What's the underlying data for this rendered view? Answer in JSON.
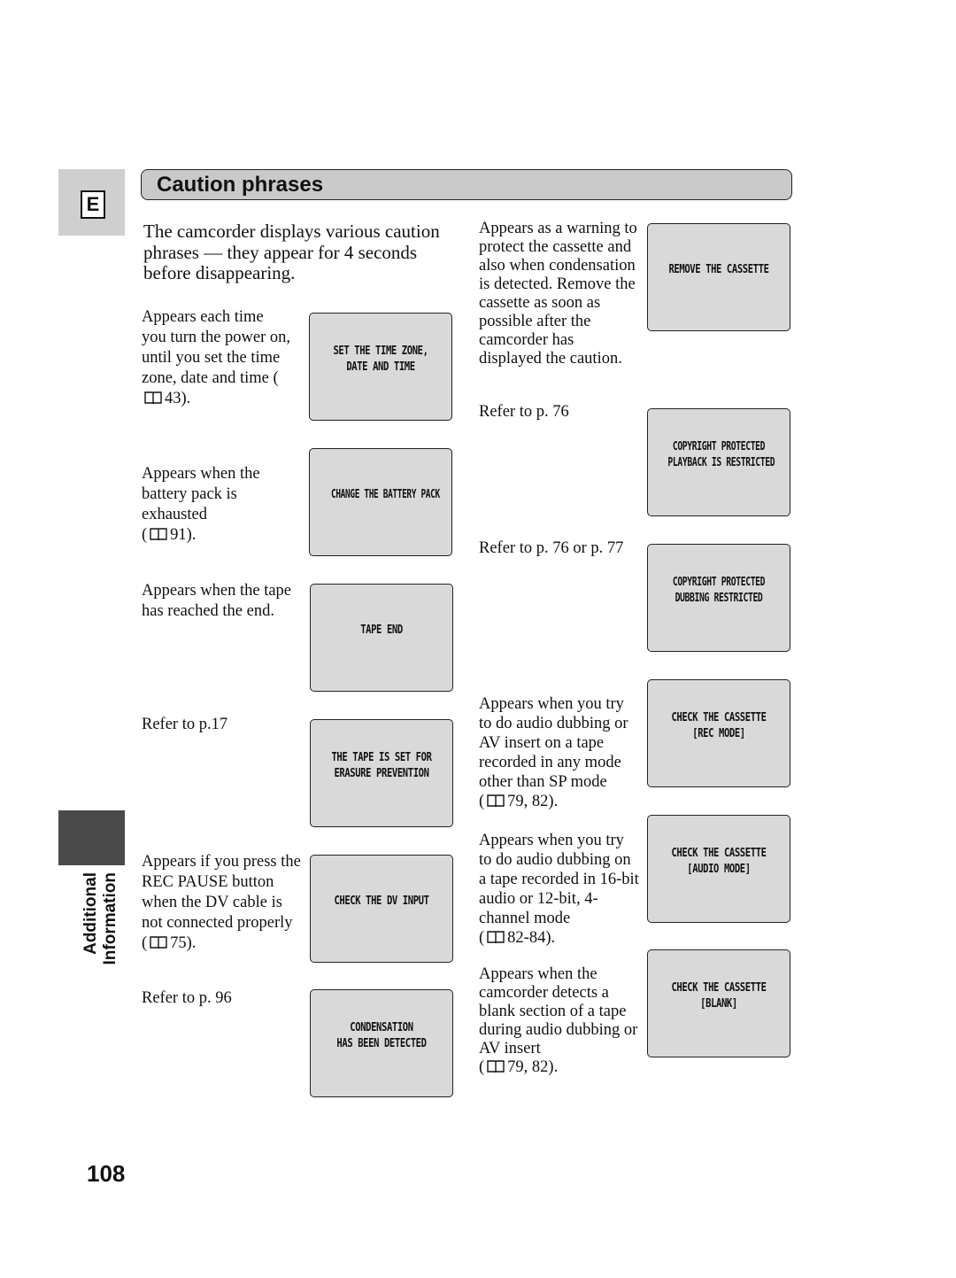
{
  "section_letter": "E",
  "title": "Caution phrases",
  "intro": "The camcorder displays various caution phrases — they appear for 4 seconds before disappearing.",
  "side_label": {
    "line1": "Additional",
    "line2": "Information"
  },
  "page_number": "108",
  "left_items": [
    {
      "desc": "Appears each time you turn the power on, until you set the time zone, date and time (",
      "ref": "43).",
      "has_book": true,
      "screen": "SET THE TIME ZONE,\nDATE AND TIME"
    },
    {
      "desc": "Appears when the battery pack is exhausted\n(",
      "ref": "91).",
      "has_book": true,
      "screen": "CHANGE THE BATTERY PACK"
    },
    {
      "desc": "Appears when the tape has reached the end.",
      "ref": "",
      "has_book": false,
      "screen": "TAPE END"
    },
    {
      "desc": "Refer to p.17",
      "ref": "",
      "has_book": false,
      "screen": "THE TAPE IS SET FOR\nERASURE PREVENTION"
    },
    {
      "desc": "Appears if you press the REC PAUSE button when the DV cable is not connected properly (",
      "ref": "75).",
      "has_book": true,
      "screen": "CHECK THE DV INPUT"
    },
    {
      "desc": "Refer to p. 96",
      "ref": "",
      "has_book": false,
      "screen": "CONDENSATION\nHAS BEEN DETECTED"
    }
  ],
  "right_items": [
    {
      "desc": "Appears as a warning to protect the cassette and also when condensation is detected. Remove the cassette as soon as possible after the camcorder has displayed the caution.",
      "ref": "",
      "has_book": false,
      "screen": "REMOVE THE CASSETTE"
    },
    {
      "desc": "Refer to p. 76",
      "ref": "",
      "has_book": false,
      "screen": "COPYRIGHT PROTECTED\nPLAYBACK IS RESTRICTED"
    },
    {
      "desc": "Refer to p. 76 or p. 77",
      "ref": "",
      "has_book": false,
      "screen": "COPYRIGHT PROTECTED\nDUBBING RESTRICTED"
    },
    {
      "desc": "Appears when you try to do audio dubbing or AV insert on a tape recorded in any mode other than SP mode\n(",
      "ref": "79, 82).",
      "has_book": true,
      "screen": "CHECK THE CASSETTE\n[REC MODE]"
    },
    {
      "desc": "Appears when you try to do audio dubbing on a tape recorded in 16-bit audio or 12-bit, 4-channel mode\n(",
      "ref": "82-84).",
      "has_book": true,
      "screen": "CHECK THE CASSETTE\n[AUDIO MODE]"
    },
    {
      "desc": "Appears when the camcorder detects a blank section of a tape during audio dubbing or AV insert\n(",
      "ref": "79, 82).",
      "has_book": true,
      "screen": "CHECK THE CASSETTE\n[BLANK]"
    }
  ],
  "colors": {
    "title_bar": "#c9c9c9",
    "screen_bg": "#d9d9d9",
    "side_block": "#4a4a4a",
    "e_tab": "#cfcfcf"
  }
}
